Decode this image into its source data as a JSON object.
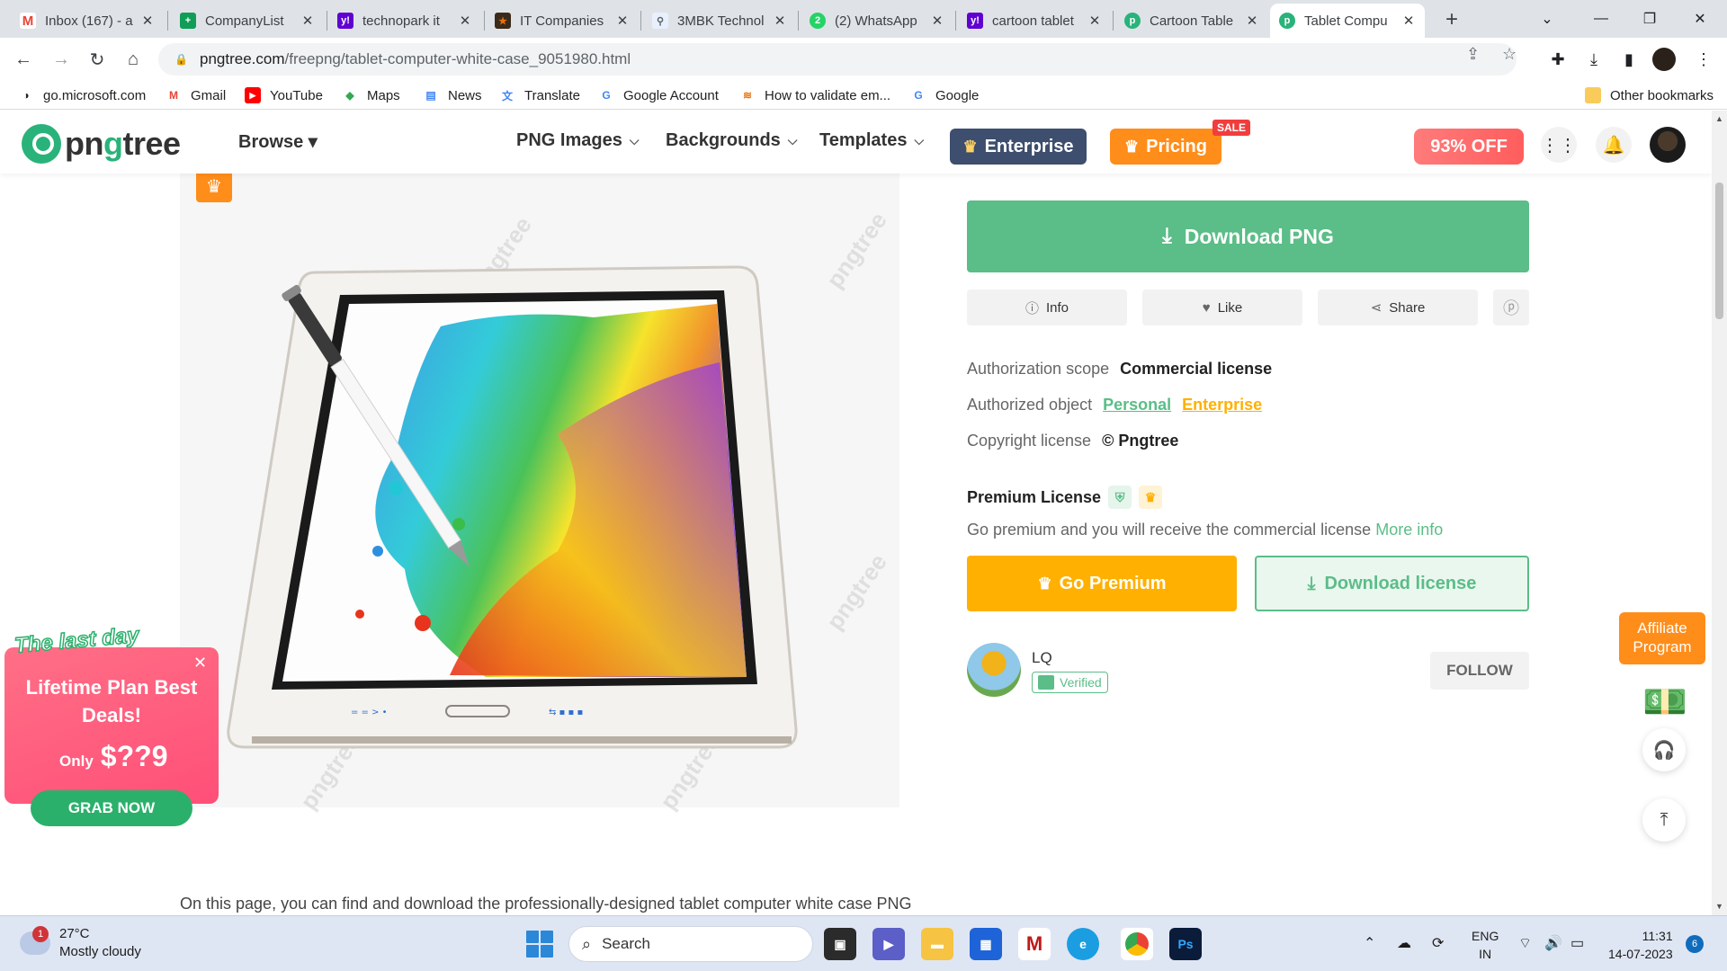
{
  "browser": {
    "tabs": [
      {
        "title": "Inbox (167) - a",
        "icon": "gmail-icon",
        "color": "#ea4335"
      },
      {
        "title": "CompanyList",
        "icon": "sheets-icon",
        "color": "#0f9d58"
      },
      {
        "title": "technopark it",
        "icon": "yahoo-icon",
        "color": "#6001d2"
      },
      {
        "title": "IT Companies",
        "icon": "star-icon",
        "color": "#e8710a"
      },
      {
        "title": "3MBK Technol",
        "icon": "link-icon",
        "color": "#5f6368"
      },
      {
        "title": "(2) WhatsApp",
        "icon": "whatsapp-icon",
        "color": "#25d366"
      },
      {
        "title": "cartoon tablet",
        "icon": "yahoo-icon",
        "color": "#6001d2"
      },
      {
        "title": "Cartoon Table",
        "icon": "pngtree-icon",
        "color": "#29b37a"
      },
      {
        "title": "Tablet Compu",
        "icon": "pngtree-icon",
        "color": "#29b37a"
      }
    ],
    "url_host": "pngtree.com",
    "url_path": "/freepng/tablet-computer-white-case_9051980.html",
    "bookmarks": [
      {
        "label": "go.microsoft.com",
        "icon": "microsoft-icon"
      },
      {
        "label": "Gmail",
        "icon": "gmail-icon"
      },
      {
        "label": "YouTube",
        "icon": "youtube-icon"
      },
      {
        "label": "Maps",
        "icon": "maps-icon"
      },
      {
        "label": "News",
        "icon": "news-icon"
      },
      {
        "label": "Translate",
        "icon": "translate-icon"
      },
      {
        "label": "Google Account",
        "icon": "google-icon"
      },
      {
        "label": "How to validate em...",
        "icon": "page-icon"
      },
      {
        "label": "Google",
        "icon": "google-icon"
      }
    ],
    "other_bookmarks": "Other bookmarks"
  },
  "site": {
    "logo_prefix": "pn",
    "logo_g": "g",
    "logo_suffix": "tree",
    "browse": "Browse ▾",
    "nav": [
      "PNG Images",
      "Backgrounds",
      "Templates"
    ],
    "enterprise": "Enterprise",
    "pricing": "Pricing",
    "sale": "SALE",
    "discount": "93% OFF"
  },
  "detail": {
    "download_png": "Download PNG",
    "actions": [
      "Info",
      "Like",
      "Share"
    ],
    "auth_scope_label": "Authorization scope",
    "auth_scope_value": "Commercial license",
    "auth_object_label": "Authorized object",
    "auth_object_personal": "Personal",
    "auth_object_enterprise": "Enterprise",
    "copyright_label": "Copyright license",
    "copyright_value": "© Pngtree",
    "premium_title": "Premium License",
    "premium_desc": "Go premium and you will receive the commercial license",
    "more_info": "More info",
    "go_premium": "Go Premium",
    "download_license": "Download license",
    "author_name": "LQ",
    "verified": "Verified",
    "follow": "FOLLOW",
    "page_description": "On this page, you can find and download the professionally-designed tablet computer white case PNG"
  },
  "watermark": "pngtree",
  "promo": {
    "ribbon": "The last day",
    "title": "Lifetime Plan Best Deals!",
    "only": "Only",
    "price": "$??9",
    "grab": "GRAB NOW"
  },
  "affiliate": "Affiliate Program",
  "taskbar": {
    "temp": "27°C",
    "weather": "Mostly cloudy",
    "weather_alerts": "1",
    "search": "Search",
    "lang_1": "ENG",
    "lang_2": "IN",
    "time": "11:31",
    "date": "14-07-2023",
    "notifications": "6"
  },
  "colors": {
    "brand_green": "#5bbd87",
    "premium_orange": "#ffb000",
    "pricing_orange": "#ff8d1a",
    "enterprise_navy": "#3d4e6e"
  }
}
